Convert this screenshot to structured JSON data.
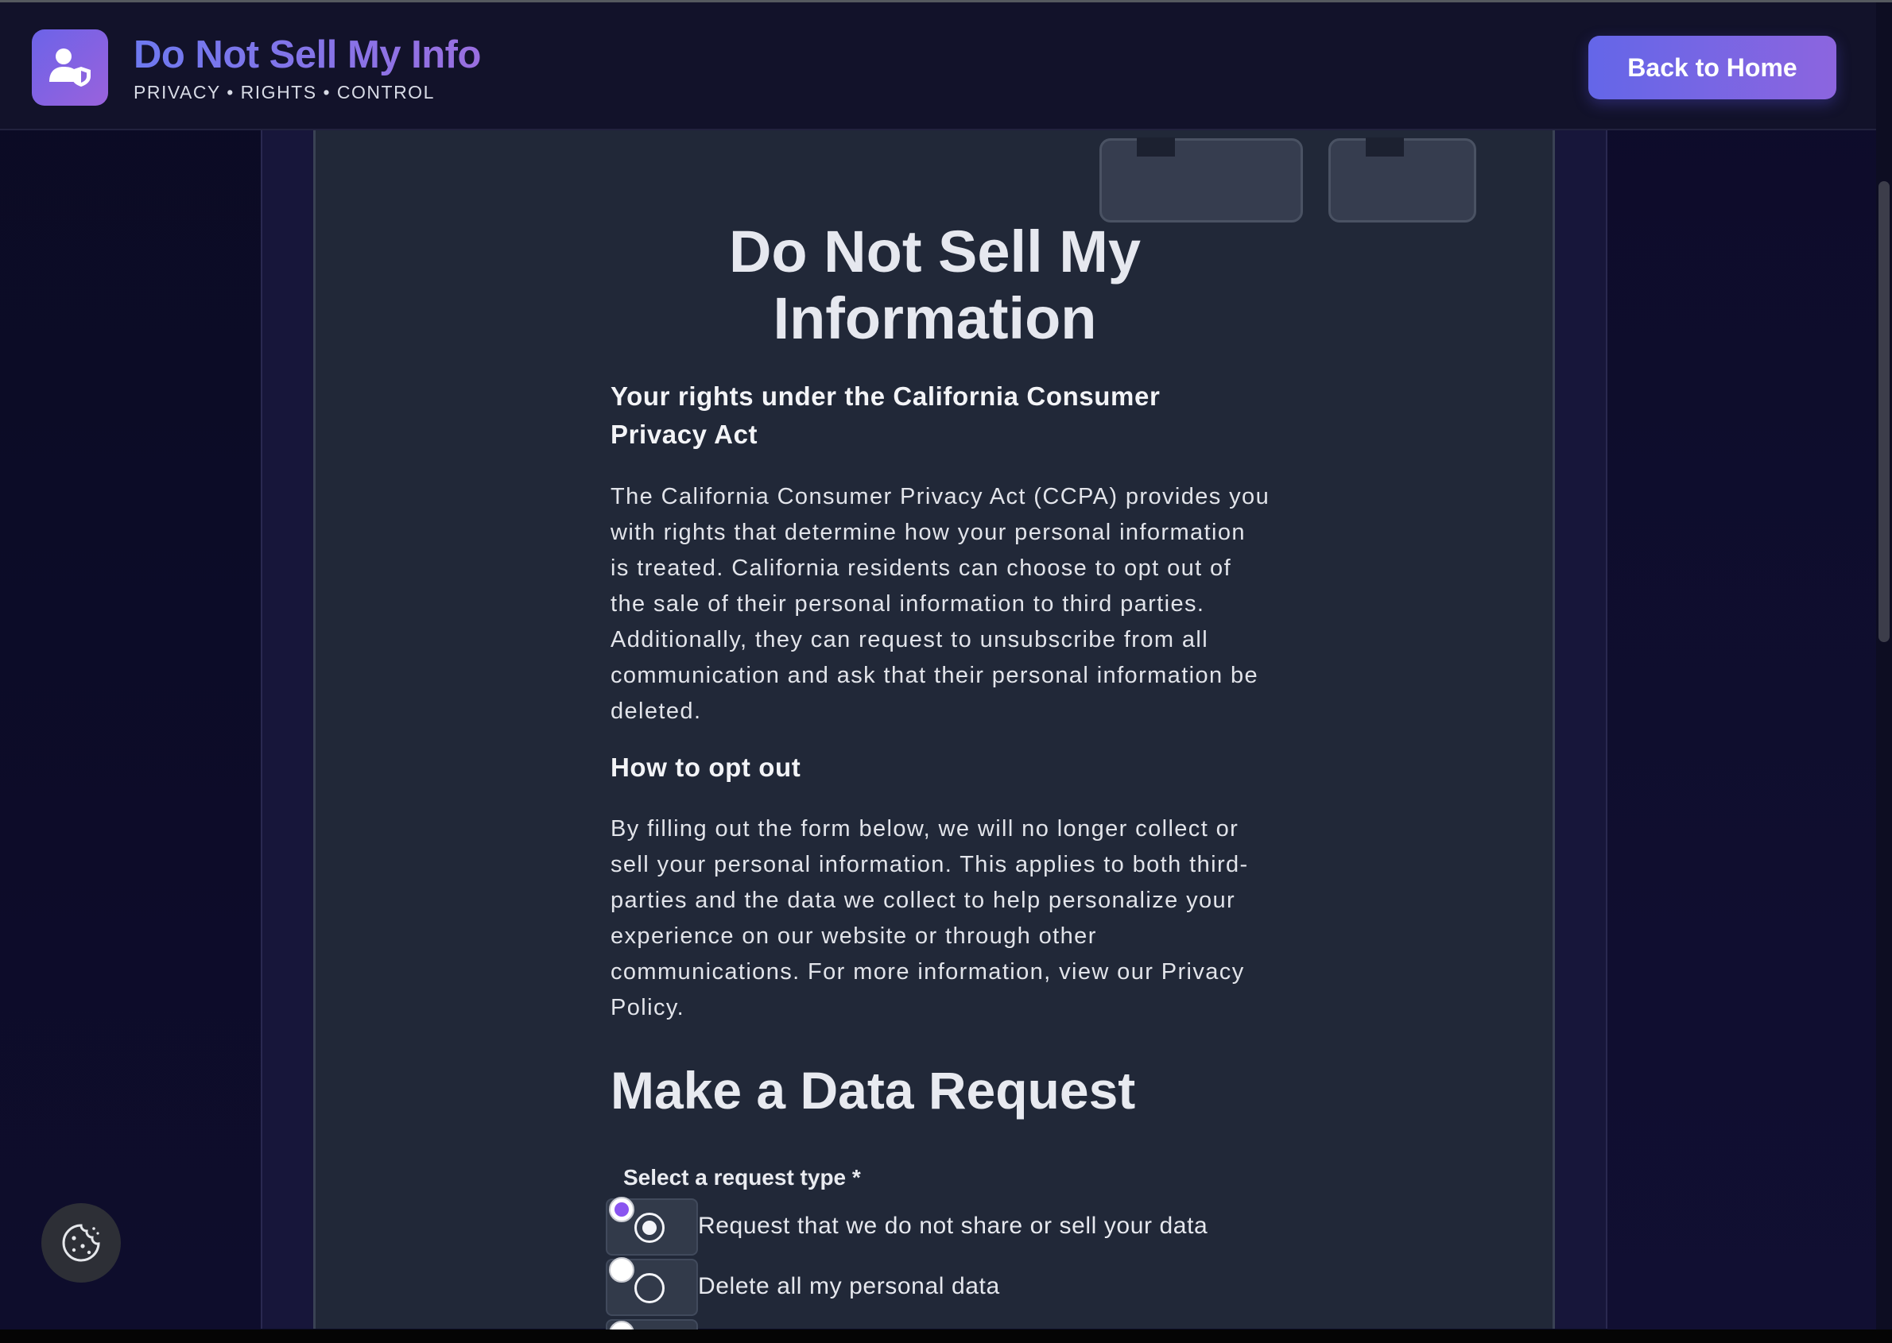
{
  "header": {
    "brand_title": "Do Not Sell My Info",
    "brand_tagline": "PRIVACY • RIGHTS • CONTROL",
    "back_button": "Back to Home",
    "logo_icon": "user-shield-icon"
  },
  "main": {
    "title": "Do Not Sell My Information",
    "rights_heading": "Your rights under the California Consumer Privacy Act",
    "rights_text": "The California Consumer Privacy Act (CCPA) provides you with rights that determine how your personal information is treated. California residents can choose to opt out of the sale of their personal information to third parties. Additionally, they can request to unsubscribe from all communication and ask that their personal information be deleted.",
    "optout_heading": "How to opt out",
    "optout_text": "By filling out the form below, we will no longer collect or sell your personal information. This applies to both third-parties and the data we collect to help personalize your experience on our website or through other communications. For more information, view our Privacy Policy.",
    "form_heading": "Make a Data Request"
  },
  "form": {
    "request_type_label": "Select a request type *",
    "options": [
      {
        "label": "Request that we do not share or sell your data",
        "selected": true
      },
      {
        "label": "Delete all my personal data",
        "selected": false
      }
    ]
  },
  "floating": {
    "cookie_icon": "cookie-icon"
  },
  "colors": {
    "accent_start": "#6466e8",
    "accent_end": "#8c65df",
    "card_bg": "#212838",
    "page_bg": "#0c0c26"
  }
}
